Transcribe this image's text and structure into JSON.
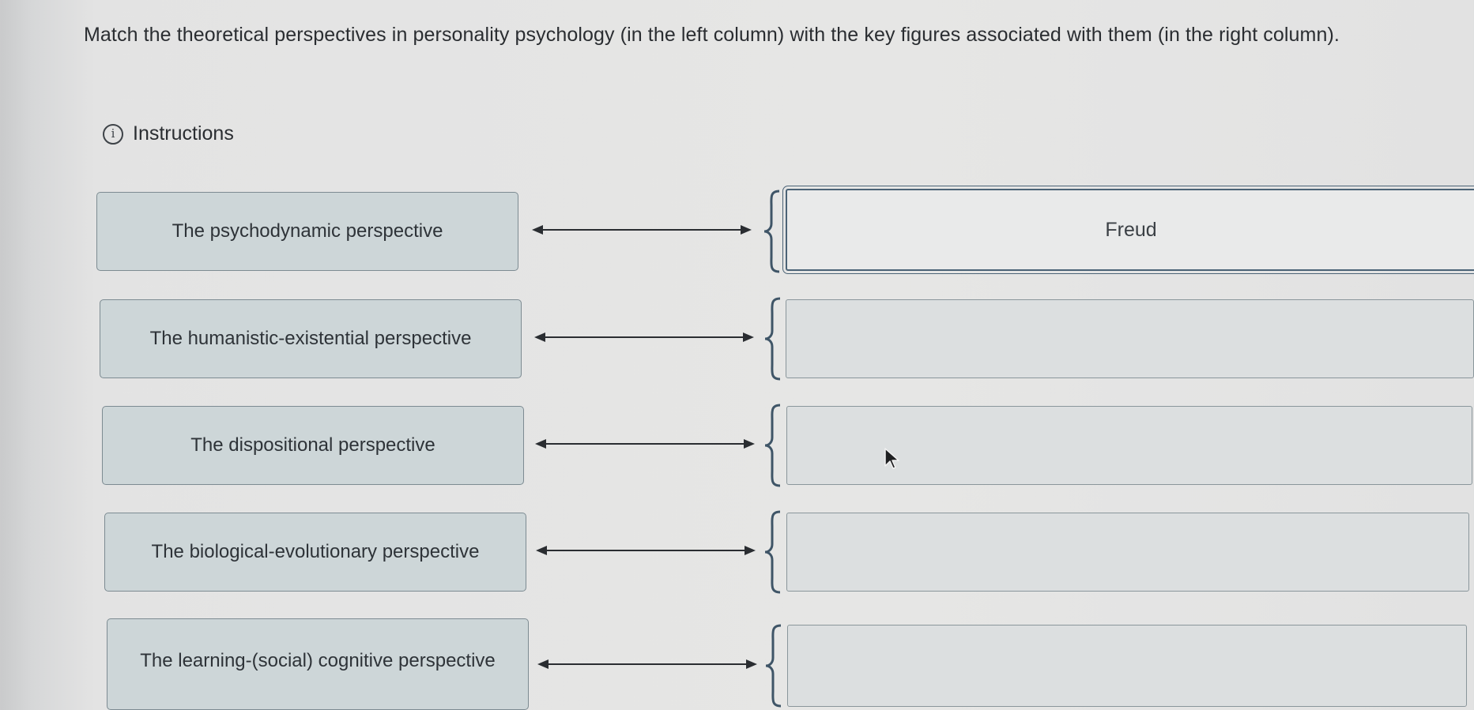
{
  "question": "Match the theoretical perspectives in personality psychology (in the left column) with the key figures associated with them (in the right column).",
  "instructions_label": "Instructions",
  "info_icon_glyph": "i",
  "rows": [
    {
      "perspective": "The psychodynamic perspective",
      "answer": "Freud"
    },
    {
      "perspective": "The humanistic-existential perspective",
      "answer": ""
    },
    {
      "perspective": "The dispositional perspective",
      "answer": ""
    },
    {
      "perspective": "The biological-evolutionary perspective",
      "answer": ""
    },
    {
      "perspective": "The learning-(social) cognitive perspective",
      "answer": ""
    }
  ],
  "colors": {
    "left_box_fill": "#cdd6d8",
    "left_box_border": "#7d8b92",
    "right_box_fill": "#dcdfe0",
    "selected_border": "#4b6376",
    "arrow": "#2a2d31",
    "brace": "#3f5567"
  },
  "icons": [
    "info-icon",
    "double-headed-arrow-icon",
    "left-brace-icon",
    "mouse-pointer-icon"
  ]
}
